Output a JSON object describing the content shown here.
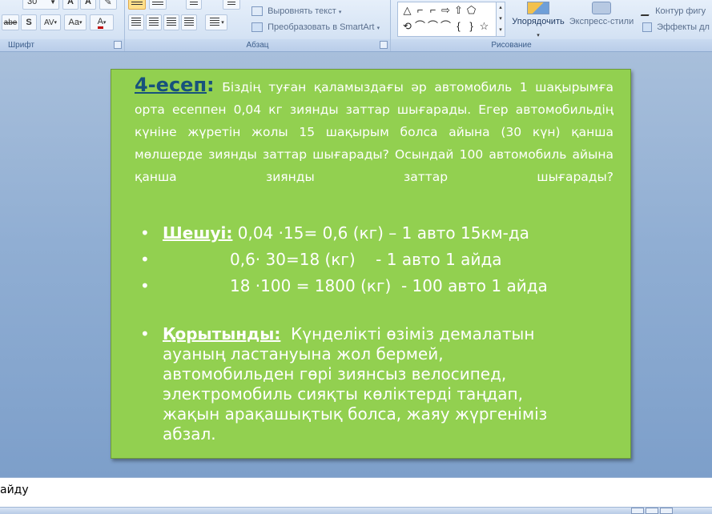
{
  "ribbon": {
    "font_group": {
      "label": "Шрифт",
      "font_size_value": "30",
      "buttons": [
        "abe",
        "S",
        "AV",
        "Aa",
        "A"
      ]
    },
    "paragraph_group": {
      "label": "Абзац",
      "align_text": "Выровнять текст",
      "convert_smartart": "Преобразовать в SmartArt"
    },
    "drawing_group": {
      "label": "Рисование",
      "arrange": "Упорядочить",
      "quick_styles": "Экспресс-стили",
      "shape_outline": "Контур фигу",
      "shape_effects": "Эффекты дл"
    },
    "shape_glyphs": [
      "△",
      "⌐",
      "⌐",
      "⇨",
      "⇧",
      "⬠",
      "⟲",
      "⌒",
      "⌒",
      "⌒",
      "{",
      "}",
      "☆"
    ]
  },
  "slide": {
    "problem": {
      "title": "4-есеп",
      "colon": ":",
      "text": "Біздің туған қаламыздағы әр автомобиль 1 шақырымға орта есеппен 0,04 кг зиянды заттар шығарады. Егер автомобильдің күніне жүретін жолы 15 шақырым болса айына (30 күн) қанша мөлшерде зиянды заттар шығарады? Осындай 100 автомобиль айына қанша зиянды заттар шығарады?"
    },
    "solution": {
      "label": "Шешуі:",
      "line1": " 0,04 ·15= 0,6 (кг) – 1 авто 15км-да",
      "line2": "0,6· 30=18 (кг)    - 1 авто 1 айда",
      "line3": "18 ·100 = 1800 (кг)  - 100 авто 1 айда"
    },
    "conclusion": {
      "label": "Қорытынды:",
      "text": "  Күнделікті өзіміз демалатын ауаның ластануына жол бермей, автомобильден гөрі зиянсыз велосипед, электромобиль сияқты көліктерді таңдап, жақын арақашықтық болса, жаяу жүргеніміз абзал."
    }
  },
  "notes": {
    "text": "айду"
  },
  "colors": {
    "slide_background": "#92d050",
    "title_color": "#17527c",
    "body_text": "#ffffff"
  }
}
